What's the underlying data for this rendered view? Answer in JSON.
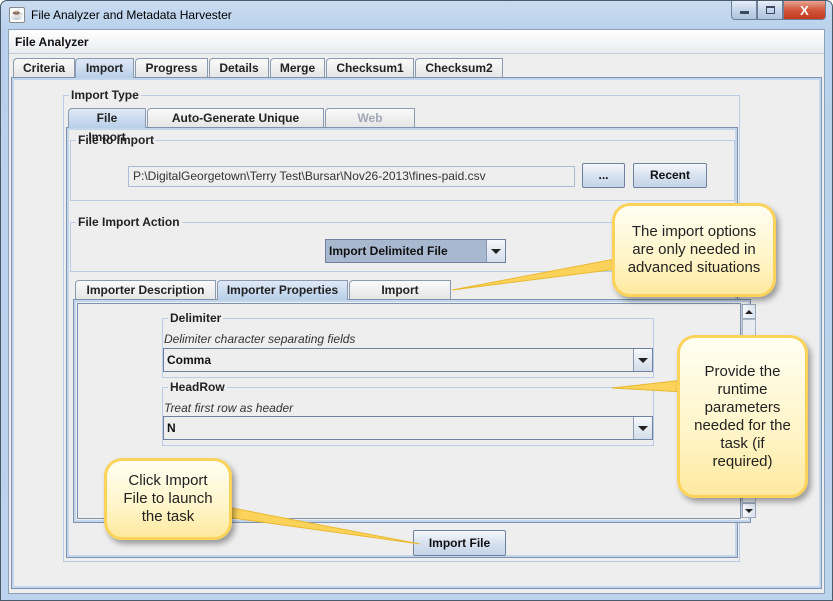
{
  "window": {
    "title": "File Analyzer and Metadata Harvester",
    "icon": "java-cup-icon",
    "controls": {
      "minimize": "minimize-icon",
      "maximize": "maximize-icon",
      "close": "close-icon",
      "close_glyph": "X"
    }
  },
  "menubar": {
    "label": "File Analyzer"
  },
  "main_tabs": [
    {
      "label": "Criteria",
      "active": false
    },
    {
      "label": "Import",
      "active": true
    },
    {
      "label": "Progress",
      "active": false
    },
    {
      "label": "Details",
      "active": false
    },
    {
      "label": "Merge",
      "active": false
    },
    {
      "label": "Checksum1",
      "active": false
    },
    {
      "label": "Checksum2",
      "active": false
    }
  ],
  "import_type": {
    "legend": "Import Type",
    "tabs": [
      {
        "label": "File Import",
        "active": true,
        "enabled": true
      },
      {
        "label": "Auto-Generate Unique Keys",
        "active": false,
        "enabled": true
      },
      {
        "label": "Web Harvest",
        "active": false,
        "enabled": false
      }
    ]
  },
  "file_to_import": {
    "legend": "File to Import",
    "path": "P:\\DigitalGeorgetown\\Terry Test\\Bursar\\Nov26-2013\\fines-paid.csv",
    "browse_label": "...",
    "recent_label": "Recent"
  },
  "file_import_action": {
    "legend": "File Import Action",
    "selected": "Import Delimited File"
  },
  "importer_tabs": [
    {
      "label": "Importer Description",
      "active": false
    },
    {
      "label": "Importer Properties",
      "active": true
    },
    {
      "label": "Import Options",
      "active": false
    }
  ],
  "properties": [
    {
      "legend": "Delimiter",
      "description": "Delimiter character separating fields",
      "value": "Comma"
    },
    {
      "legend": "HeadRow",
      "description": "Treat first row as header",
      "value": "N"
    }
  ],
  "import_button": {
    "label": "Import File"
  },
  "callouts": [
    {
      "id": "import-options",
      "text": "The import options are only needed in advanced situations"
    },
    {
      "id": "runtime-params",
      "text": "Provide the runtime parameters needed for the task (if required)"
    },
    {
      "id": "import-file",
      "text": "Click Import File to launch the task"
    }
  ]
}
